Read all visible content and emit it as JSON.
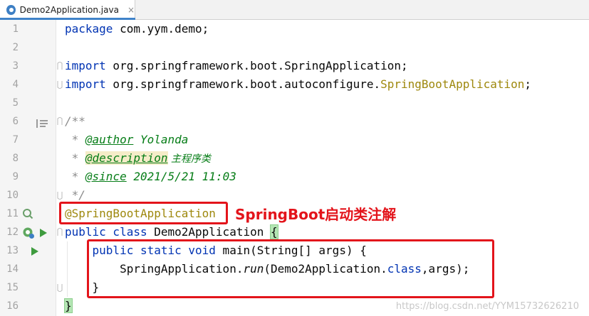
{
  "tab": {
    "file_name": "Demo2Application.java",
    "close_glyph": "×",
    "icon": "java-class-icon"
  },
  "line_numbers": [
    "1",
    "2",
    "3",
    "4",
    "5",
    "6",
    "7",
    "8",
    "9",
    "10",
    "11",
    "12",
    "13",
    "14",
    "15",
    "16"
  ],
  "code": {
    "l1_kw": "package",
    "l1_text": " com.yym.demo;",
    "l3_kw": "import",
    "l3_text": " org.springframework.boot.SpringApplication;",
    "l4_kw": "import",
    "l4_text": " org.springframework.boot.autoconfigure.",
    "l4_ann": "SpringBootApplication",
    "l4_end": ";",
    "l6": "/**",
    "l7_prefix": " * ",
    "l7_tag": "@author",
    "l7_text": " Yolanda",
    "l8_prefix": " * ",
    "l8_tag": "@description",
    "l8_text": " 主程序类",
    "l9_prefix": " * ",
    "l9_tag": "@since",
    "l9_text": " 2021/5/21 11:03",
    "l10": " */",
    "l11_ann": "@SpringBootApplication",
    "l12_kw": "public class",
    "l12_text": " Demo2Application ",
    "l12_brace": "{",
    "l13_indent": "    ",
    "l13_kw": "public static void",
    "l13_text": " main(String[] args) {",
    "l14_indent": "        ",
    "l14_a": "SpringApplication.",
    "l14_b": "run",
    "l14_c": "(Demo2Application.",
    "l14_kw": "class",
    "l14_d": ",args);",
    "l15_indent": "    ",
    "l15_text": "}",
    "l16_text": "}"
  },
  "annotation_note": "SpringBoot启动类注解",
  "watermark": "https://blog.csdn.net/YYM15732626210",
  "colors": {
    "keyword": "#0033b3",
    "annotation": "#9e880d",
    "doc_comment": "#067d17",
    "highlight_box": "#e3141b"
  }
}
